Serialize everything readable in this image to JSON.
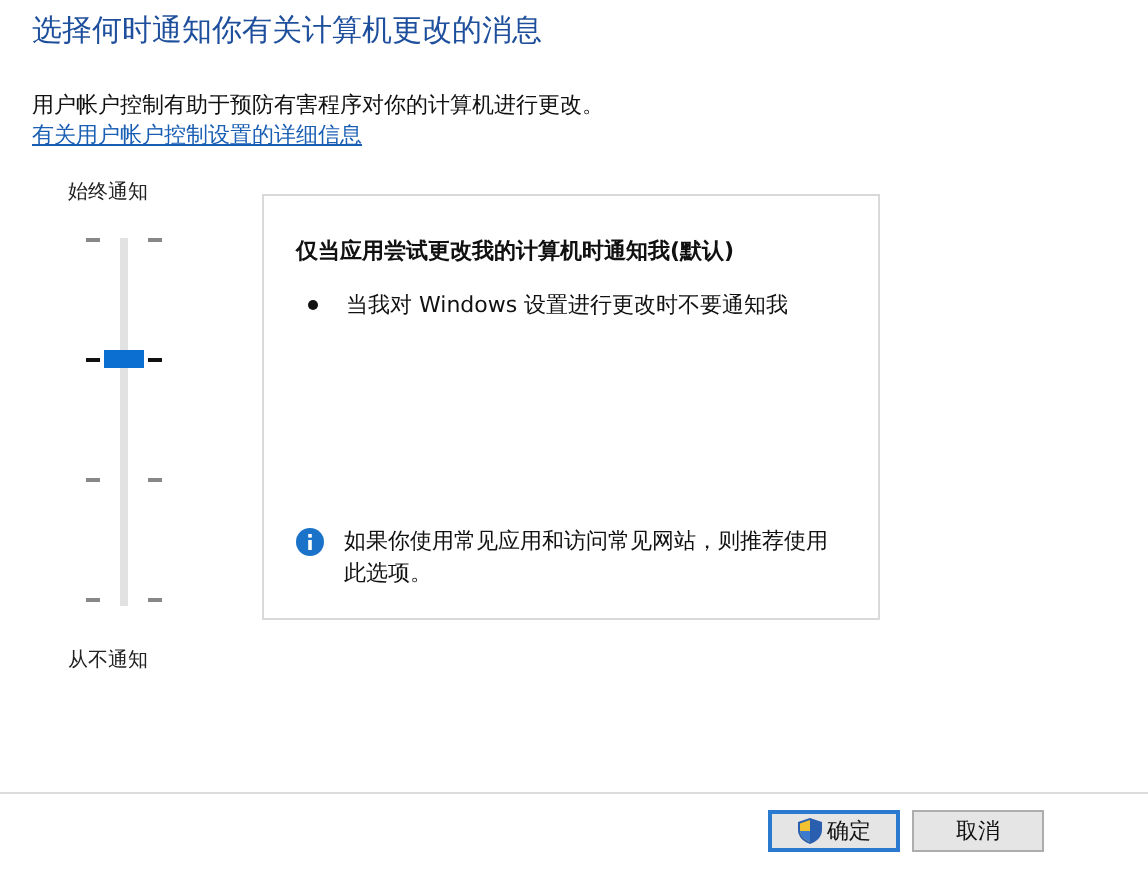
{
  "title": "选择何时通知你有关计算机更改的消息",
  "description": "用户帐户控制有助于预防有害程序对你的计算机进行更改。",
  "link": "有关用户帐户控制设置的详细信息",
  "slider": {
    "top_label": "始终通知",
    "bottom_label": "从不通知",
    "level": 0.6667
  },
  "panel": {
    "heading": "仅当应用尝试更改我的计算机时通知我(默认)",
    "bullets": [
      "当我对 Windows 设置进行更改时不要通知我"
    ],
    "note": "如果你使用常见应用和访问常见网站，则推荐使用此选项。"
  },
  "buttons": [
    {
      "label": "确定",
      "kind": "shield",
      "default": true
    },
    {
      "label": "取消",
      "kind": "plain",
      "default": false
    }
  ]
}
